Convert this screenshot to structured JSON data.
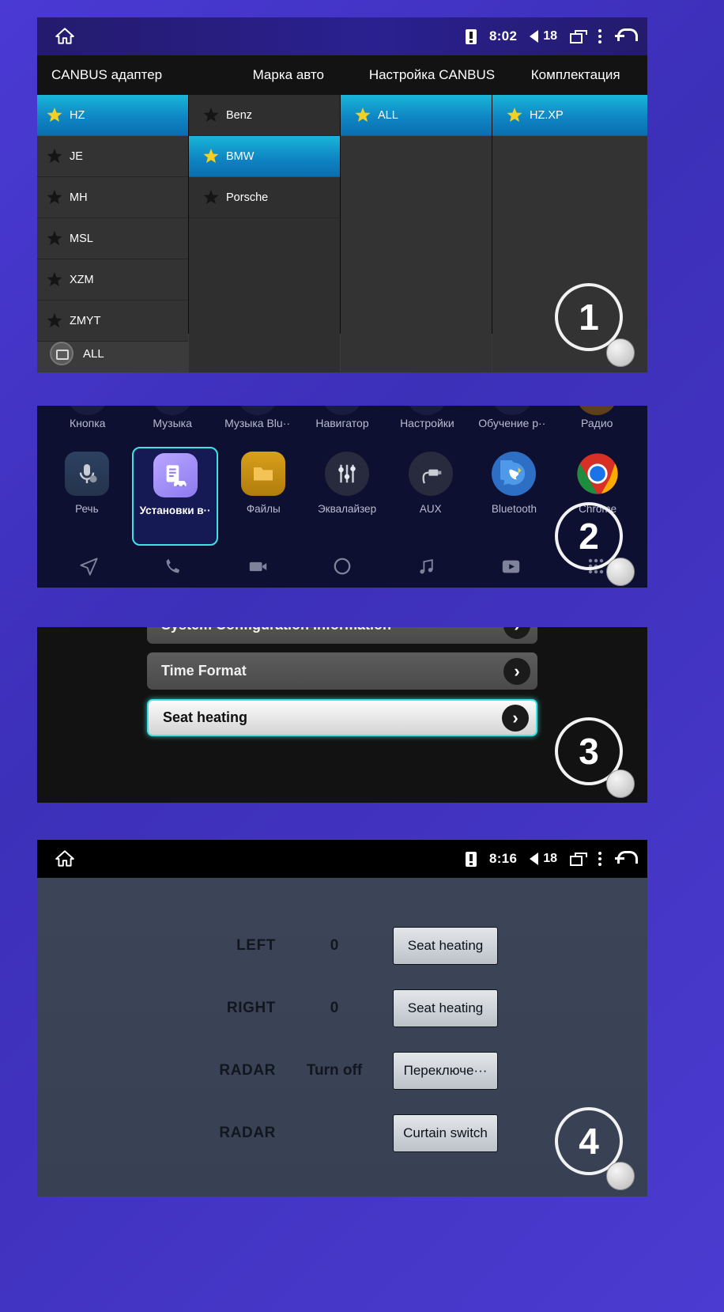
{
  "panel1": {
    "badge": "1",
    "statusbar": {
      "time": "8:02",
      "volume": "18",
      "home_icon": "home-icon",
      "sd_icon": "sd-card-icon",
      "volume_icon": "volume-icon",
      "recents_icon": "recents-icon",
      "menu_icon": "overflow-menu-icon",
      "back_icon": "back-icon"
    },
    "tabs": [
      {
        "label": "CANBUS адаптер"
      },
      {
        "label": "Марка авто"
      },
      {
        "label": "Настройка CANBUS"
      },
      {
        "label": "Комплектация"
      }
    ],
    "col1": [
      {
        "label": "HZ",
        "selected": true
      },
      {
        "label": "JE",
        "selected": false
      },
      {
        "label": "MH",
        "selected": false
      },
      {
        "label": "MSL",
        "selected": false
      },
      {
        "label": "XZM",
        "selected": false
      },
      {
        "label": "ZMYT",
        "selected": false
      }
    ],
    "col2": [
      {
        "label": "Benz",
        "selected": false
      },
      {
        "label": "BMW",
        "selected": true
      },
      {
        "label": "Porsche",
        "selected": false
      }
    ],
    "col3": [
      {
        "label": "ALL",
        "selected": true
      }
    ],
    "col4": [
      {
        "label": "HZ.XP",
        "selected": true
      }
    ],
    "bottom": {
      "label": "ALL",
      "icon": "globe-icon"
    }
  },
  "panel2": {
    "badge": "2",
    "row_labels_top": [
      "Кнопка",
      "Музыка",
      "Музыка Blu··",
      "Навигатор",
      "Настройки",
      "Обучение р··",
      "Радио"
    ],
    "apps": [
      {
        "name": "Речь",
        "icon": "microphone-settings-icon",
        "active": false
      },
      {
        "name": "Установки в··",
        "icon": "car-settings-icon",
        "active": true
      },
      {
        "name": "Файлы",
        "icon": "folder-icon",
        "active": false
      },
      {
        "name": "Эквалайзер",
        "icon": "equalizer-icon",
        "active": false
      },
      {
        "name": "AUX",
        "icon": "aux-plug-icon",
        "active": false
      },
      {
        "name": "Bluetooth",
        "icon": "bluetooth-phone-icon",
        "active": false
      },
      {
        "name": "Chrome",
        "icon": "chrome-icon",
        "active": false
      }
    ],
    "dock": [
      "navigation-icon",
      "phone-icon",
      "camera-icon",
      "circle-icon",
      "music-note-icon",
      "video-icon",
      "apps-icon"
    ]
  },
  "panel3": {
    "badge": "3",
    "rows": [
      {
        "label": "System Configuration Information",
        "highlighted": false,
        "clipped": true
      },
      {
        "label": "Time Format",
        "highlighted": false,
        "clipped": false
      },
      {
        "label": "Seat heating",
        "highlighted": true,
        "clipped": false
      }
    ],
    "chevron_icon": "chevron-right-icon"
  },
  "panel4": {
    "badge": "4",
    "statusbar": {
      "time": "8:16",
      "volume": "18",
      "home_icon": "home-icon",
      "sd_icon": "sd-card-icon",
      "volume_icon": "volume-icon",
      "recents_icon": "recents-icon",
      "menu_icon": "overflow-menu-icon",
      "back_icon": "back-icon"
    },
    "rows": [
      {
        "label": "LEFT",
        "value": "0",
        "button": "Seat heating"
      },
      {
        "label": "RIGHT",
        "value": "0",
        "button": "Seat heating"
      },
      {
        "label": "RADAR",
        "value": "Turn off",
        "button": "Переключе···"
      },
      {
        "label": "RADAR",
        "value": "",
        "button": "Curtain switch"
      }
    ]
  },
  "colors": {
    "page_background": "#4436c8",
    "selection_cyan": "#14a0cc",
    "highlight_cyan": "#3fe3e3",
    "star_gold": "#f5d021",
    "panel_dark": "#2b2b2b",
    "panel4_background": "#3b4559"
  }
}
